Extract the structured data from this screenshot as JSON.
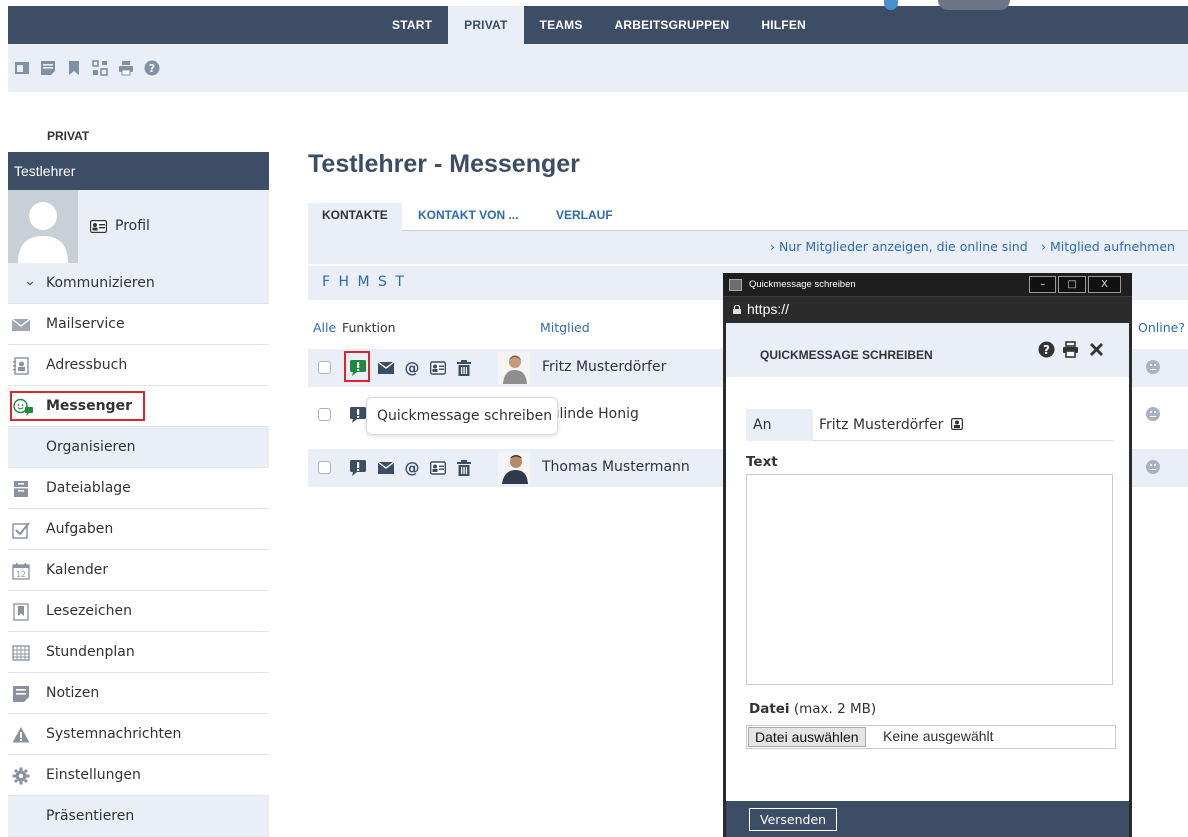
{
  "topnav": [
    "START",
    "PRIVAT",
    "TEAMS",
    "ARBEITSGRUPPEN",
    "HILFEN"
  ],
  "topnav_active": "PRIVAT",
  "toolbar_icons": [
    "window-icon",
    "note-icon",
    "bookmark-icon",
    "sitemap-icon",
    "print-icon",
    "help-icon"
  ],
  "sidebar": {
    "section_title": "PRIVAT",
    "user": "Testlehrer",
    "profile_link": "Profil",
    "group_toggle": "Kommunizieren",
    "items": [
      {
        "label": "Mailservice",
        "icon": "envelope-icon"
      },
      {
        "label": "Adressbuch",
        "icon": "address-book-icon"
      },
      {
        "label": "Messenger",
        "icon": "messenger-icon",
        "active": true
      },
      {
        "label": "Organisieren",
        "group": true
      },
      {
        "label": "Dateiablage",
        "icon": "file-cabinet-icon"
      },
      {
        "label": "Aufgaben",
        "icon": "checkbox-icon"
      },
      {
        "label": "Kalender",
        "icon": "calendar-icon"
      },
      {
        "label": "Lesezeichen",
        "icon": "bookmark-icon"
      },
      {
        "label": "Stundenplan",
        "icon": "timetable-icon"
      },
      {
        "label": "Notizen",
        "icon": "note-icon"
      },
      {
        "label": "Systemnachrichten",
        "icon": "warning-icon"
      },
      {
        "label": "Einstellungen",
        "icon": "gear-icon"
      },
      {
        "label": "Präsentieren",
        "group": true
      }
    ],
    "calendar_day": "12"
  },
  "main": {
    "title": "Testlehrer - Messenger",
    "tabs": [
      "KONTAKTE",
      "KONTAKT VON ...",
      "VERLAUF"
    ],
    "actions": [
      "Nur Mitglieder anzeigen, die online sind",
      "Mitglied aufnehmen"
    ],
    "letters": "F H M S T",
    "columns": {
      "alle": "Alle",
      "funktion": "Funktion",
      "mitglied": "Mitglied",
      "online": "Online?"
    },
    "rows": [
      {
        "name": "Fritz Musterdörfer"
      },
      {
        "name": "Sieglinde Honig",
        "visible": "eglinde Honig"
      },
      {
        "name": "Thomas Mustermann"
      }
    ],
    "tooltip": "Quickmessage schreiben"
  },
  "popup": {
    "window_title": "Quickmessage schreiben",
    "window_buttons": [
      "–",
      "□",
      "X"
    ],
    "url": "https://",
    "heading": "QUICKMESSAGE SCHREIBEN",
    "to_label": "An",
    "to_value": "Fritz Musterdörfer",
    "text_label": "Text",
    "file_label": "Datei",
    "file_hint": "(max. 2 MB)",
    "file_button": "Datei auswählen",
    "file_status": "Keine ausgewählt",
    "send": "Versenden"
  },
  "colors": {
    "nav_bg": "#3d4d66",
    "light_bg": "#e9eef7",
    "link": "#2e6bb5",
    "highlight": "#d9262c",
    "qm_green": "#1f8a3b"
  }
}
